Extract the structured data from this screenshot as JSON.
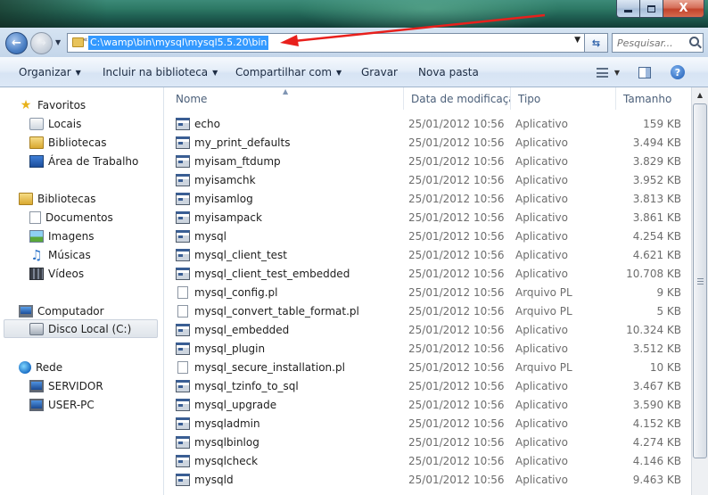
{
  "window": {
    "minimize_icon": "minimize-icon",
    "maximize_icon": "maximize-icon",
    "close_label": "X"
  },
  "address": {
    "path": "C:\\wamp\\bin\\mysql\\mysql5.5.20\\bin",
    "separator": "«",
    "search_placeholder": "Pesquisar..."
  },
  "toolbar": {
    "organize": "Organizar",
    "include_library": "Incluir na biblioteca",
    "share": "Compartilhar com",
    "burn": "Gravar",
    "new_folder": "Nova pasta",
    "help": "?"
  },
  "sidebar": {
    "favorites": "Favoritos",
    "fav_items": [
      "Locais",
      "Bibliotecas",
      "Área de Trabalho"
    ],
    "libraries": "Bibliotecas",
    "lib_items": [
      "Documentos",
      "Imagens",
      "Músicas",
      "Vídeos"
    ],
    "computer": "Computador",
    "computer_items": [
      "Disco Local (C:)"
    ],
    "network": "Rede",
    "network_items": [
      "SERVIDOR",
      "USER-PC"
    ]
  },
  "columns": {
    "name": "Nome",
    "date": "Data de modificaçã...",
    "type": "Tipo",
    "size": "Tamanho"
  },
  "files": [
    {
      "name": "echo",
      "date": "25/01/2012 10:56",
      "type": "Aplicativo",
      "size": "159 KB",
      "icon": "app"
    },
    {
      "name": "my_print_defaults",
      "date": "25/01/2012 10:56",
      "type": "Aplicativo",
      "size": "3.494 KB",
      "icon": "app"
    },
    {
      "name": "myisam_ftdump",
      "date": "25/01/2012 10:56",
      "type": "Aplicativo",
      "size": "3.829 KB",
      "icon": "app"
    },
    {
      "name": "myisamchk",
      "date": "25/01/2012 10:56",
      "type": "Aplicativo",
      "size": "3.952 KB",
      "icon": "app"
    },
    {
      "name": "myisamlog",
      "date": "25/01/2012 10:56",
      "type": "Aplicativo",
      "size": "3.813 KB",
      "icon": "app"
    },
    {
      "name": "myisampack",
      "date": "25/01/2012 10:56",
      "type": "Aplicativo",
      "size": "3.861 KB",
      "icon": "app"
    },
    {
      "name": "mysql",
      "date": "25/01/2012 10:56",
      "type": "Aplicativo",
      "size": "4.254 KB",
      "icon": "app"
    },
    {
      "name": "mysql_client_test",
      "date": "25/01/2012 10:56",
      "type": "Aplicativo",
      "size": "4.621 KB",
      "icon": "app"
    },
    {
      "name": "mysql_client_test_embedded",
      "date": "25/01/2012 10:56",
      "type": "Aplicativo",
      "size": "10.708 KB",
      "icon": "app"
    },
    {
      "name": "mysql_config.pl",
      "date": "25/01/2012 10:56",
      "type": "Arquivo PL",
      "size": "9 KB",
      "icon": "pl"
    },
    {
      "name": "mysql_convert_table_format.pl",
      "date": "25/01/2012 10:56",
      "type": "Arquivo PL",
      "size": "5 KB",
      "icon": "pl"
    },
    {
      "name": "mysql_embedded",
      "date": "25/01/2012 10:56",
      "type": "Aplicativo",
      "size": "10.324 KB",
      "icon": "app"
    },
    {
      "name": "mysql_plugin",
      "date": "25/01/2012 10:56",
      "type": "Aplicativo",
      "size": "3.512 KB",
      "icon": "app"
    },
    {
      "name": "mysql_secure_installation.pl",
      "date": "25/01/2012 10:56",
      "type": "Arquivo PL",
      "size": "10 KB",
      "icon": "pl"
    },
    {
      "name": "mysql_tzinfo_to_sql",
      "date": "25/01/2012 10:56",
      "type": "Aplicativo",
      "size": "3.467 KB",
      "icon": "app"
    },
    {
      "name": "mysql_upgrade",
      "date": "25/01/2012 10:56",
      "type": "Aplicativo",
      "size": "3.590 KB",
      "icon": "app"
    },
    {
      "name": "mysqladmin",
      "date": "25/01/2012 10:56",
      "type": "Aplicativo",
      "size": "4.152 KB",
      "icon": "app"
    },
    {
      "name": "mysqlbinlog",
      "date": "25/01/2012 10:56",
      "type": "Aplicativo",
      "size": "4.274 KB",
      "icon": "app"
    },
    {
      "name": "mysqlcheck",
      "date": "25/01/2012 10:56",
      "type": "Aplicativo",
      "size": "4.146 KB",
      "icon": "app"
    },
    {
      "name": "mysqld",
      "date": "25/01/2012 10:56",
      "type": "Aplicativo",
      "size": "9.463 KB",
      "icon": "app"
    }
  ],
  "colors": {
    "selection": "#3399ff",
    "annotation_arrow": "#e8201c",
    "secondary_text": "#6d6d6d"
  }
}
